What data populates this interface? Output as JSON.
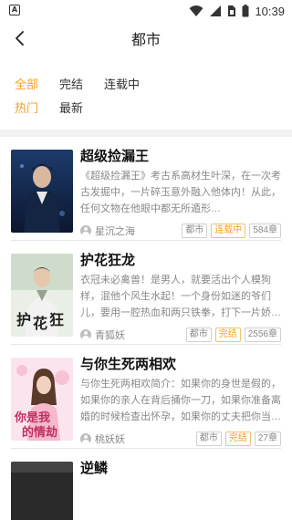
{
  "status_bar": {
    "left_badge": "A",
    "time": "10:39",
    "icons": [
      "wifi-icon",
      "signal-icon",
      "sim-icon",
      "battery-icon"
    ]
  },
  "header": {
    "back_icon": "chevron-left-icon",
    "title": "都市"
  },
  "filters": {
    "status_options": [
      "全部",
      "完结",
      "连载中"
    ],
    "sort_options": [
      "热门",
      "最新"
    ],
    "active_color": "#f0a028"
  },
  "books": [
    {
      "title": "超级捡漏王",
      "description": "《超级捡漏王》考古系高材生叶深，在一次考古发掘中，一片碎玉意外融入他体内！从此，任何文物在他眼中都无所遁形…",
      "author": "星沉之海",
      "category": "都市",
      "status": "连载中",
      "chapters": "584章"
    },
    {
      "title": "护花狂龙",
      "description": "衣冠未必禽兽！是男人，就要活出个人模狗样，混他个风生水起！一个身份如迷的爷们儿，要用一腔热血和两只铁拳，打下一片娇…",
      "author": "青狐妖",
      "category": "都市",
      "status": "完结",
      "chapters": "2556章"
    },
    {
      "title": "与你生死两相欢",
      "description": "与你生死两相欢简介：如果你的身世是假的，如果你的亲人在背后捅你一刀，如果你准备离婚的时候检查出怀孕，如果你的丈夫把你当…",
      "author": "桃妖妖",
      "category": "都市",
      "status": "完结",
      "chapters": "27章"
    },
    {
      "title": "逆鳞",
      "description": "",
      "author": "",
      "category": "",
      "status": "",
      "chapters": ""
    }
  ]
}
